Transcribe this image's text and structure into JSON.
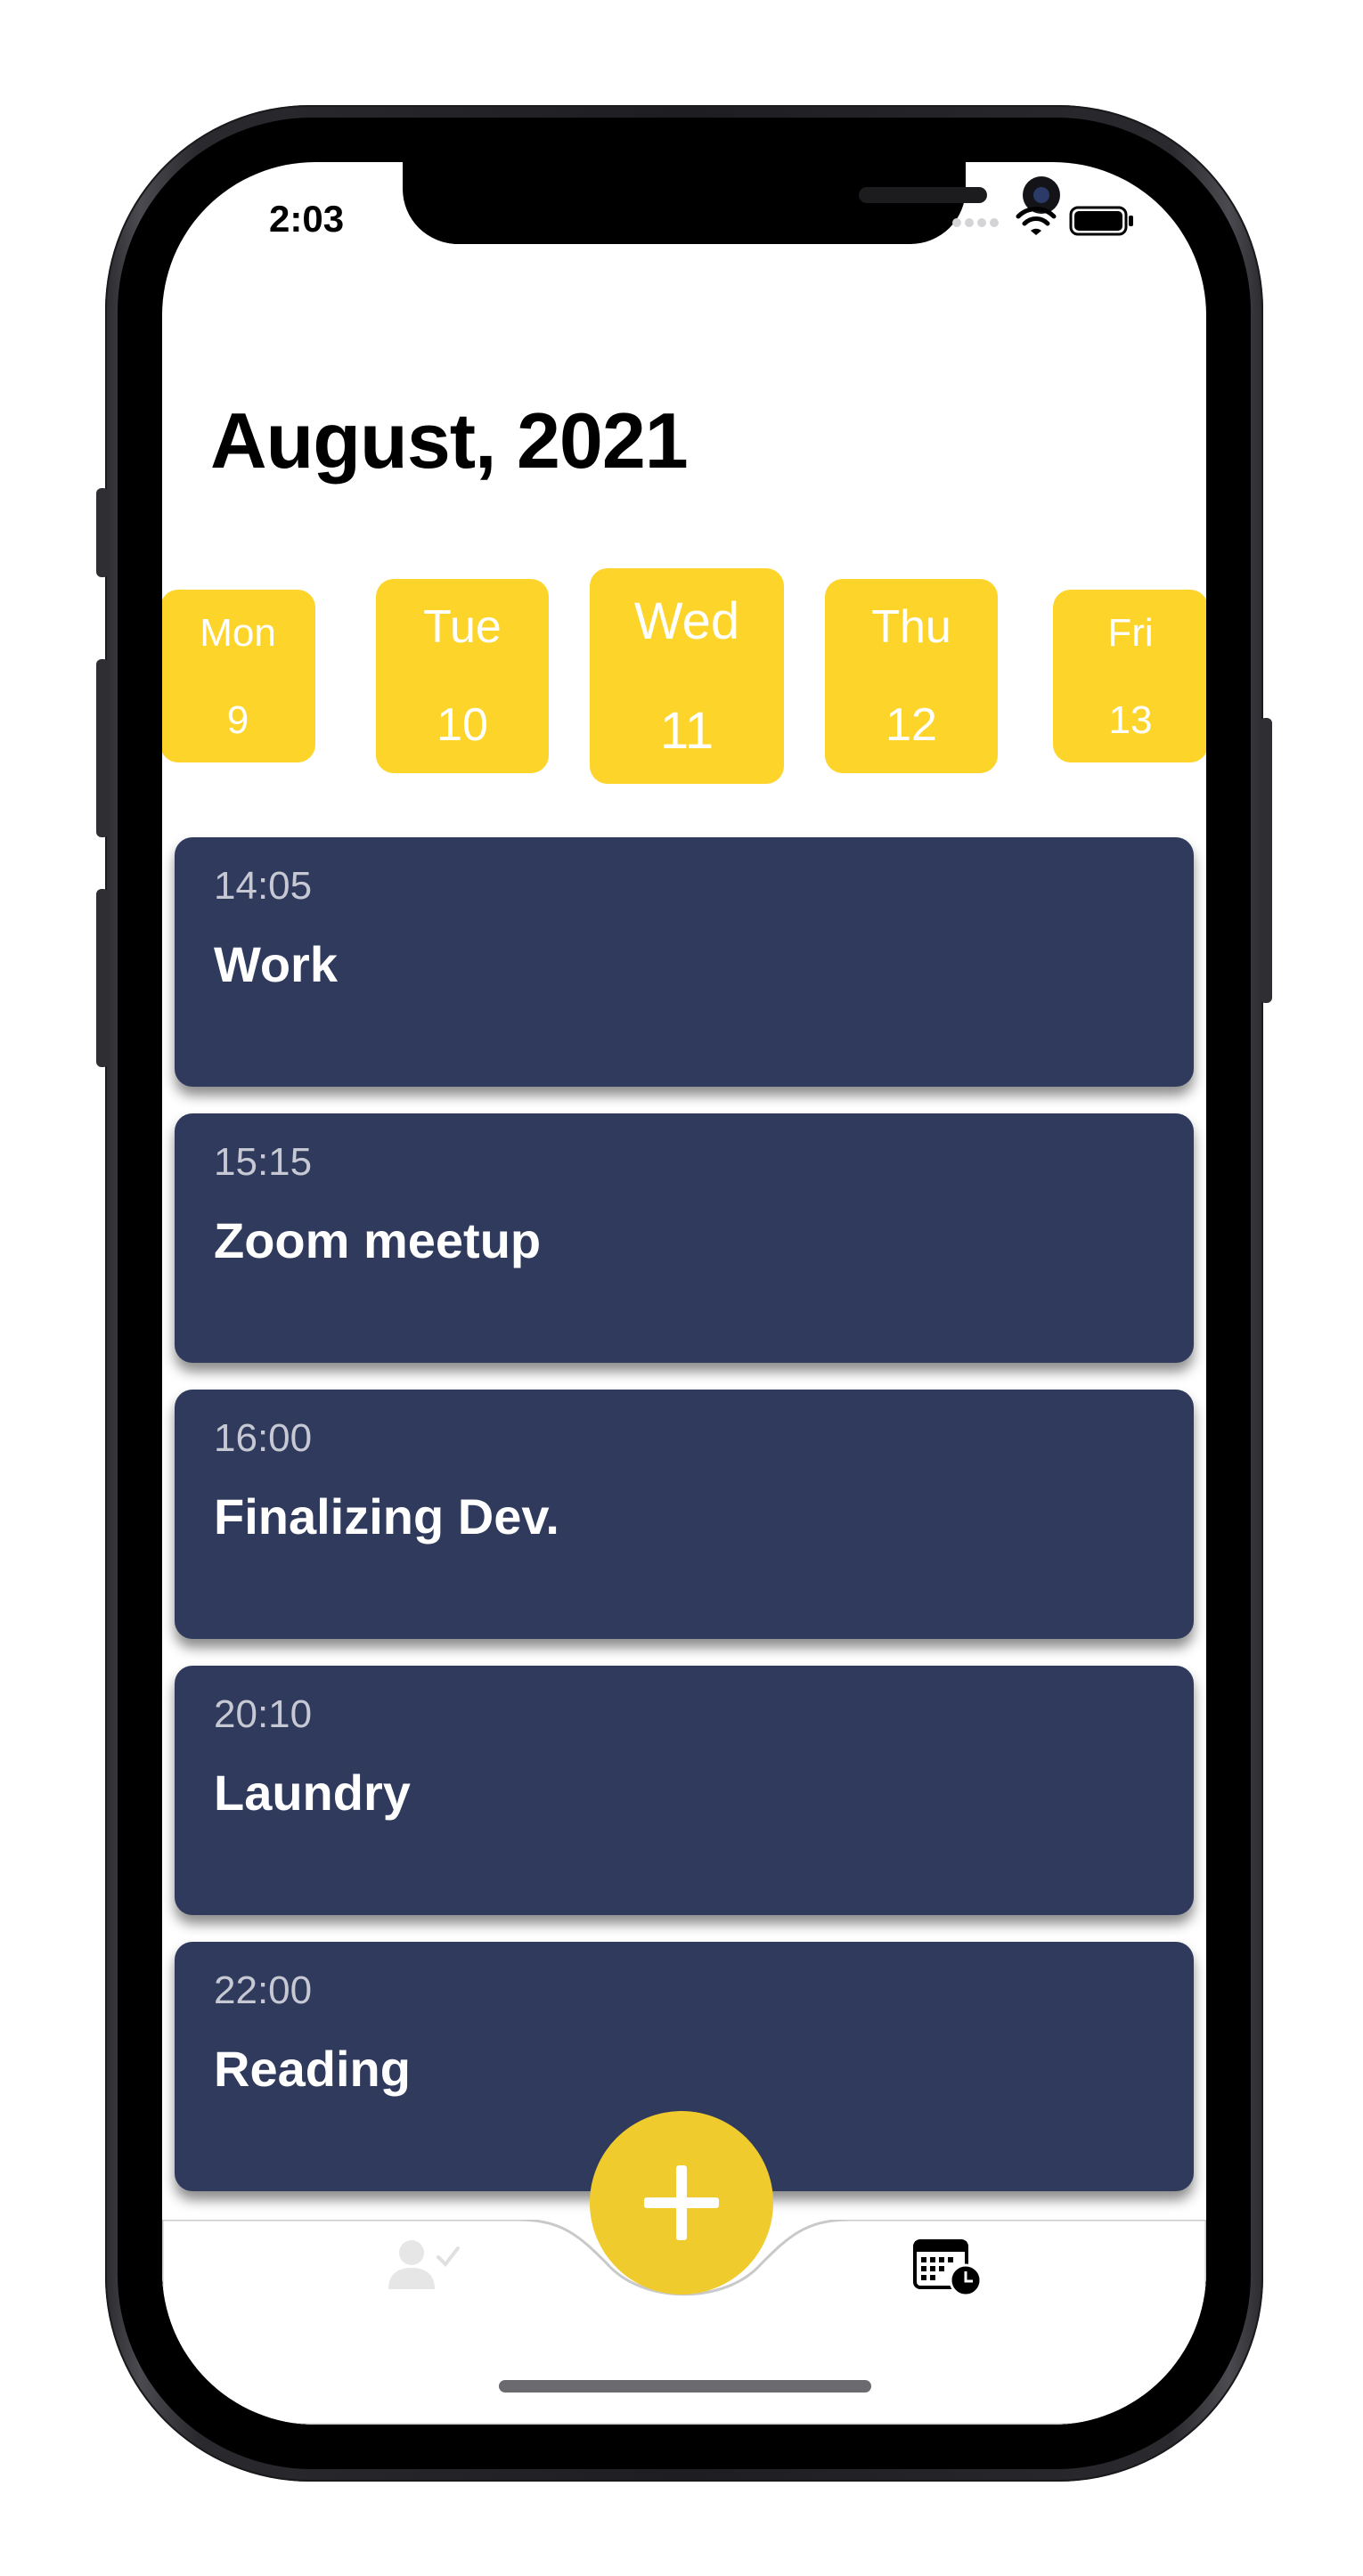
{
  "status_bar": {
    "time": "2:03"
  },
  "header": {
    "title": "August, 2021"
  },
  "days": [
    {
      "name": "Mon",
      "date": "9"
    },
    {
      "name": "Tue",
      "date": "10"
    },
    {
      "name": "Wed",
      "date": "11"
    },
    {
      "name": "Thu",
      "date": "12"
    },
    {
      "name": "Fri",
      "date": "13"
    }
  ],
  "tasks": [
    {
      "time": "14:05",
      "title": "Work"
    },
    {
      "time": "15:15",
      "title": "Zoom meetup"
    },
    {
      "time": "16:00",
      "title": "Finalizing Dev."
    },
    {
      "time": "20:10",
      "title": "Laundry"
    },
    {
      "time": "22:00",
      "title": "Reading"
    }
  ],
  "tabbar": {
    "left_icon": "person-check-icon",
    "center_icon": "plus-icon",
    "right_icon": "calendar-clock-icon"
  },
  "colors": {
    "accent": "#fdd42a",
    "card": "#2f3a5c",
    "fab": "#f0cb2e"
  }
}
